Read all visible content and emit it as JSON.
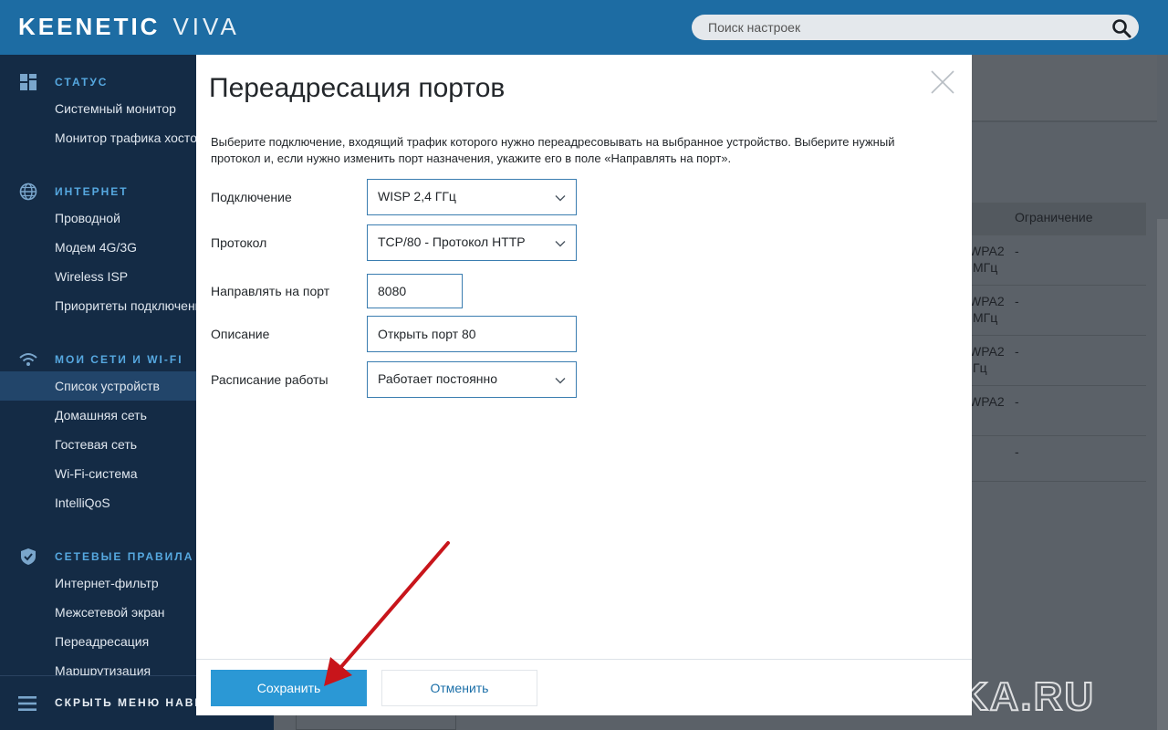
{
  "header": {
    "brand": "KEENETIC",
    "model": "VIVA",
    "search_placeholder": "Поиск настроек"
  },
  "sidebar": {
    "sections": [
      {
        "title": "СТАТУС",
        "icon": "dashboard-icon",
        "items": [
          "Системный монитор",
          "Монитор трафика хостов"
        ]
      },
      {
        "title": "ИНТЕРНЕТ",
        "icon": "globe-icon",
        "items": [
          "Проводной",
          "Модем 4G/3G",
          "Wireless ISP",
          "Приоритеты подключений"
        ]
      },
      {
        "title": "МОИ СЕТИ И WI-FI",
        "icon": "wifi-icon",
        "items": [
          "Список устройств",
          "Домашняя сеть",
          "Гостевая сеть",
          "Wi-Fi-система",
          "IntelliQoS"
        ]
      },
      {
        "title": "СЕТЕВЫЕ ПРАВИЛА",
        "icon": "shield-icon",
        "items": [
          "Интернет-фильтр",
          "Межсетевой экран",
          "Переадресация",
          "Маршрутизация"
        ]
      }
    ],
    "active_item": "Список устройств",
    "footer_label": "СКРЫТЬ МЕНЮ НАВИГАЦИИ"
  },
  "background_table": {
    "column_header": "Ограничение",
    "rows": [
      {
        "security": "WPA2",
        "band": "МГц",
        "limit": "-"
      },
      {
        "security": "WPA2",
        "band": "МГц",
        "limit": "-"
      },
      {
        "security": "WPA2",
        "band": "Гц",
        "limit": "-"
      },
      {
        "security": "WPA2",
        "band": "",
        "limit": "-"
      },
      {
        "security": "",
        "band": "",
        "limit": "-"
      }
    ]
  },
  "modal": {
    "title": "Переадресация портов",
    "description": "Выберите подключение, входящий трафик которого нужно переадресовывать на выбранное устройство. Выберите нужный протокол и, если нужно изменить порт назначения, укажите его в поле «Направлять на порт».",
    "fields": {
      "connection": {
        "label": "Подключение",
        "value": "WISP 2,4 ГГц"
      },
      "protocol": {
        "label": "Протокол",
        "value": "TCP/80 - Протокол HTTP"
      },
      "target_port": {
        "label": "Направлять на порт",
        "value": "8080"
      },
      "description": {
        "label": "Описание",
        "value": "Открыть порт 80"
      },
      "schedule": {
        "label": "Расписание работы",
        "value": "Работает постоянно"
      }
    },
    "save_label": "Сохранить",
    "cancel_label": "Отменить"
  },
  "watermark": "WIFIKA.RU",
  "colors": {
    "header_bg": "#1d6ca3",
    "sidebar_bg": "#142b45",
    "accent": "#2b98d5",
    "section_title": "#56a8e0",
    "arrow": "#c8151b"
  }
}
